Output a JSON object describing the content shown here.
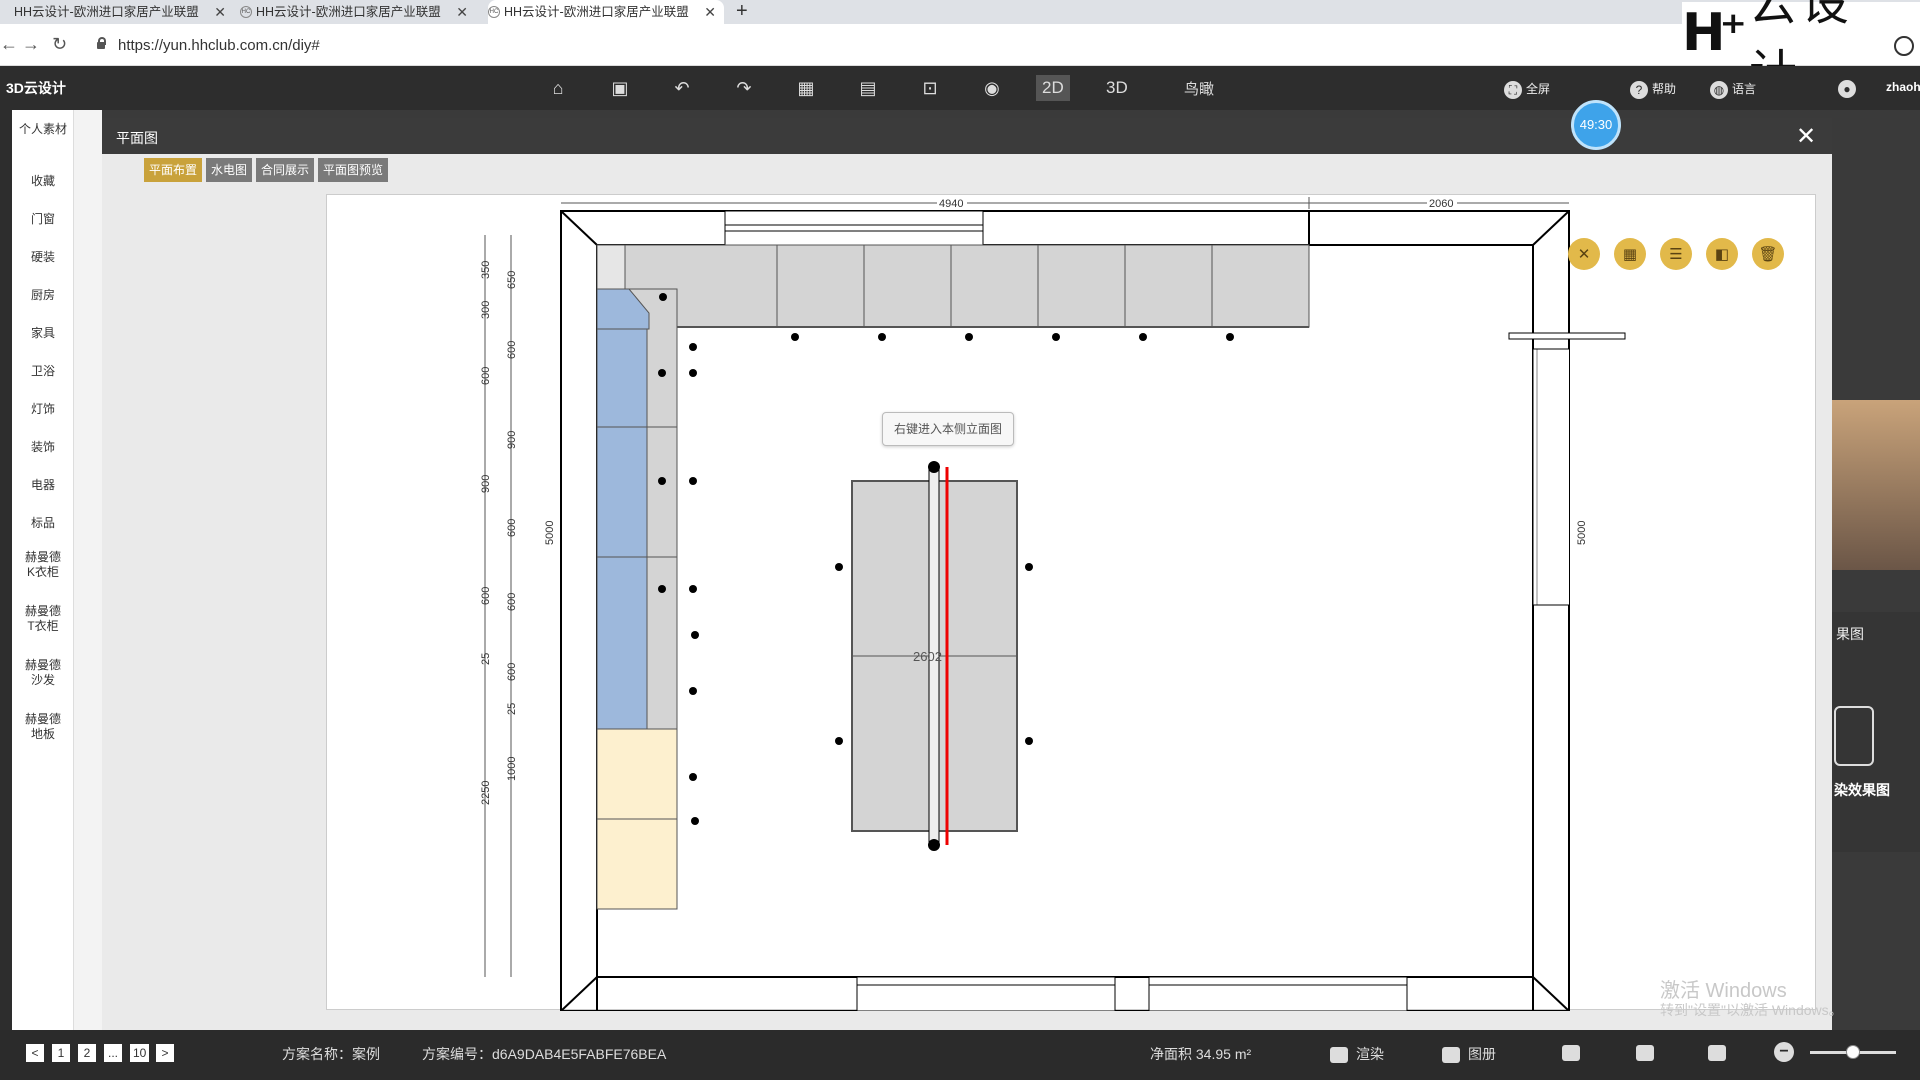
{
  "browser": {
    "tabs": [
      {
        "title": "HH云设计-欧洲进口家居产业联盟"
      },
      {
        "title": "HH云设计-欧洲进口家居产业联盟"
      },
      {
        "title": "HH云设计-欧洲进口家居产业联盟"
      }
    ],
    "url": "https://yun.hhclub.com.cn/diy#",
    "logo_text": "云设计"
  },
  "app": {
    "name": "3D云设计",
    "toolbar": {
      "mode_2d": "2D",
      "mode_3d": "3D",
      "birdview": "鸟瞰",
      "fullscreen": "全屏",
      "help": "帮助",
      "language": "语言",
      "user": "zhaoh"
    }
  },
  "categories": [
    "个人素材",
    "收藏",
    "门窗",
    "硬装",
    "厨房",
    "家具",
    "卫浴",
    "灯饰",
    "装饰",
    "电器",
    "标品",
    "赫曼德K衣柜",
    "赫曼德T衣柜",
    "赫曼德沙发",
    "赫曼德地板"
  ],
  "modal": {
    "title": "平面图",
    "close": "✕",
    "timer": "49:30",
    "tabs": [
      "平面布置",
      "水电图",
      "合同展示",
      "平面图预览"
    ],
    "active_tab": "平面布置",
    "context_hint": "右键进入本侧立面图"
  },
  "plan": {
    "top_dims": [
      "4940",
      "2060"
    ],
    "left_outer_dims": [
      "350",
      "300",
      "600",
      "900",
      "600",
      "25",
      "2250"
    ],
    "left_inner_dims": [
      "650",
      "600",
      "900",
      "600",
      "600",
      "600",
      "25",
      "1000"
    ],
    "wall_dims": [
      "5000",
      "5000"
    ],
    "island_label": "2602"
  },
  "plan_tools": [
    "measure-icon",
    "layout-icon",
    "align-icon",
    "ruler-icon",
    "delete-icon"
  ],
  "right_panel": {
    "label1": "果图",
    "label2": "染效果图"
  },
  "watermark": {
    "line1": "激活 Windows",
    "line2": "转到\"设置\"以激活 Windows。"
  },
  "status": {
    "pages": [
      "1",
      "2",
      "...",
      "10"
    ],
    "prev": "<",
    "next": ">",
    "scheme_name": "方案名称：案例",
    "scheme_code": "方案编号：d6A9DAB4E5FABFE76BEA",
    "area": "净面积 34.95 m²",
    "render": "渲染",
    "album": "图册",
    "zoom_level": 0.5
  }
}
